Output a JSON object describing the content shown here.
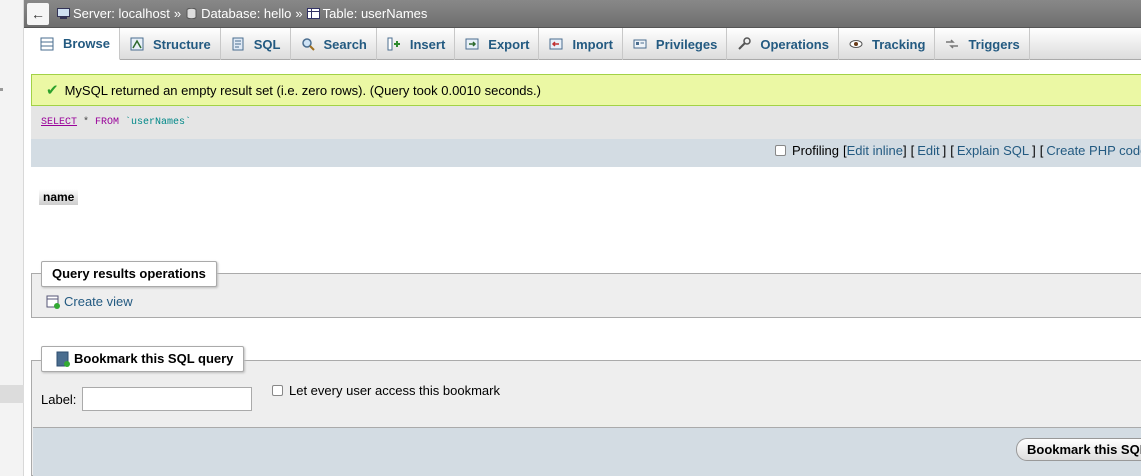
{
  "breadcrumb": {
    "back": "←",
    "server": "Server: localhost",
    "database": "Database: hello",
    "table": "Table: userNames",
    "sep": "»"
  },
  "tabs": [
    {
      "label": "Browse",
      "icon": "browse-icon"
    },
    {
      "label": "Structure",
      "icon": "structure-icon"
    },
    {
      "label": "SQL",
      "icon": "sql-icon"
    },
    {
      "label": "Search",
      "icon": "search-icon"
    },
    {
      "label": "Insert",
      "icon": "insert-icon"
    },
    {
      "label": "Export",
      "icon": "export-icon"
    },
    {
      "label": "Import",
      "icon": "import-icon"
    },
    {
      "label": "Privileges",
      "icon": "privileges-icon"
    },
    {
      "label": "Operations",
      "icon": "operations-icon"
    },
    {
      "label": "Tracking",
      "icon": "tracking-icon"
    },
    {
      "label": "Triggers",
      "icon": "triggers-icon"
    }
  ],
  "message": {
    "text": "MySQL returned an empty result set (i.e. zero rows). (Query took 0.0010 seconds.)",
    "color": "#ebf8a4"
  },
  "query": {
    "select": "SELECT",
    "star": " * ",
    "from": "FROM",
    "table": " `userNames`"
  },
  "tools": {
    "profiling": "Profiling",
    "edit_inline": "Edit inline",
    "edit": "Edit",
    "explain": "Explain SQL",
    "create_php": "Create PHP code",
    "lb": "[",
    "rb": "]"
  },
  "results": {
    "column": "name"
  },
  "query_ops": {
    "legend": "Query results operations",
    "create_view": "Create view"
  },
  "bookmark": {
    "legend": "Bookmark this SQL query",
    "label": "Label:",
    "share": "Let every user access this bookmark",
    "submit": "Bookmark this SQL query"
  },
  "colors": {
    "link": "#235a81",
    "tools_bg": "#d3dce3"
  }
}
